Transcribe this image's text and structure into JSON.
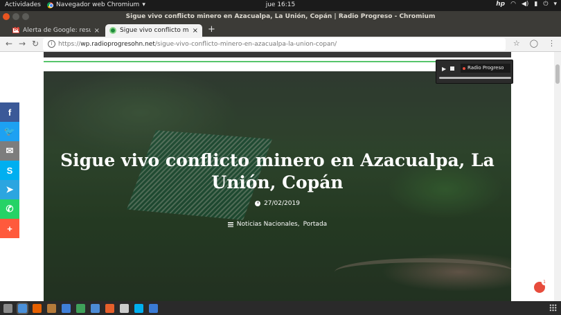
{
  "topbar": {
    "activities": "Actividades",
    "app_name": "Navegador web Chromium",
    "clock": "jue 16:15"
  },
  "window": {
    "title": "Sigue vivo conflicto minero en Azacualpa, La Unión, Copán | Radio Progreso - Chromium"
  },
  "tabs": [
    {
      "label": "Alerta de Google: resume",
      "state": "inactive",
      "icon": "gmail-icon"
    },
    {
      "label": "Sigue vivo conflicto mine",
      "state": "active",
      "icon": "radio-progreso-icon"
    }
  ],
  "omnibox": {
    "protocol": "https://",
    "domain": "wp.radioprogresohn.net",
    "path": "/sigue-vivo-conflicto-minero-en-azacualpa-la-union-copan/"
  },
  "article": {
    "title": "Sigue vivo conflicto minero en Azacualpa, La Unión, Copán",
    "date": "27/02/2019",
    "categories": [
      "Noticias Nacionales,",
      "Portada"
    ]
  },
  "player": {
    "station": "Radio Progreso"
  },
  "share": [
    {
      "name": "facebook",
      "glyph": "f",
      "color": "#3b5998"
    },
    {
      "name": "twitter",
      "glyph": "🐦",
      "color": "#1da1f2"
    },
    {
      "name": "email",
      "glyph": "✉",
      "color": "#7d7d7d"
    },
    {
      "name": "skype",
      "glyph": "S",
      "color": "#00aff0"
    },
    {
      "name": "telegram",
      "glyph": "➤",
      "color": "#2ca5e0"
    },
    {
      "name": "whatsapp",
      "glyph": "✆",
      "color": "#25d366"
    },
    {
      "name": "more",
      "glyph": "+",
      "color": "#ff5a3c"
    }
  ],
  "notification": {
    "count": "1"
  },
  "dock_colors": [
    "#8a8a8a",
    "#4a90d9",
    "#e66000",
    "#b57a3a",
    "#3f7fd8",
    "#3fa05a",
    "#4c8bd6",
    "#e65f2b",
    "#ccc",
    "#00aff0",
    "#3a7bd5"
  ]
}
